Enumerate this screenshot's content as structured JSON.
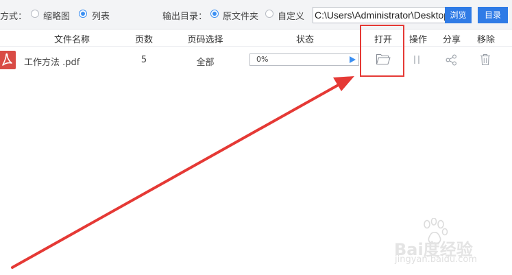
{
  "toolbar": {
    "mode_label": "方式：",
    "view_options": [
      {
        "label": "缩略图",
        "checked": false
      },
      {
        "label": "列表",
        "checked": true
      }
    ],
    "output_label": "输出目录：",
    "output_options": [
      {
        "label": "原文件夹",
        "checked": true
      },
      {
        "label": "自定义",
        "checked": false
      }
    ],
    "path_value": "C:\\Users\\Administrator\\Desktop",
    "browse_label": "浏览",
    "dir_label": "目录"
  },
  "table": {
    "headers": {
      "filename": "文件名称",
      "pages": "页数",
      "page_select": "页码选择",
      "status": "状态",
      "open": "打开",
      "action": "操作",
      "share": "分享",
      "remove": "移除"
    },
    "rows": [
      {
        "filename": "工作方法 .pdf",
        "pages": "5",
        "page_select": "全部",
        "progress_text": "0%",
        "progress": 0
      }
    ]
  },
  "watermark": {
    "logo": "Bai度经验",
    "url": "jingyan.baidu.com"
  },
  "colors": {
    "accent": "#2f7be6",
    "pdf_red": "#d94b45",
    "annotation_red": "#e53935"
  }
}
